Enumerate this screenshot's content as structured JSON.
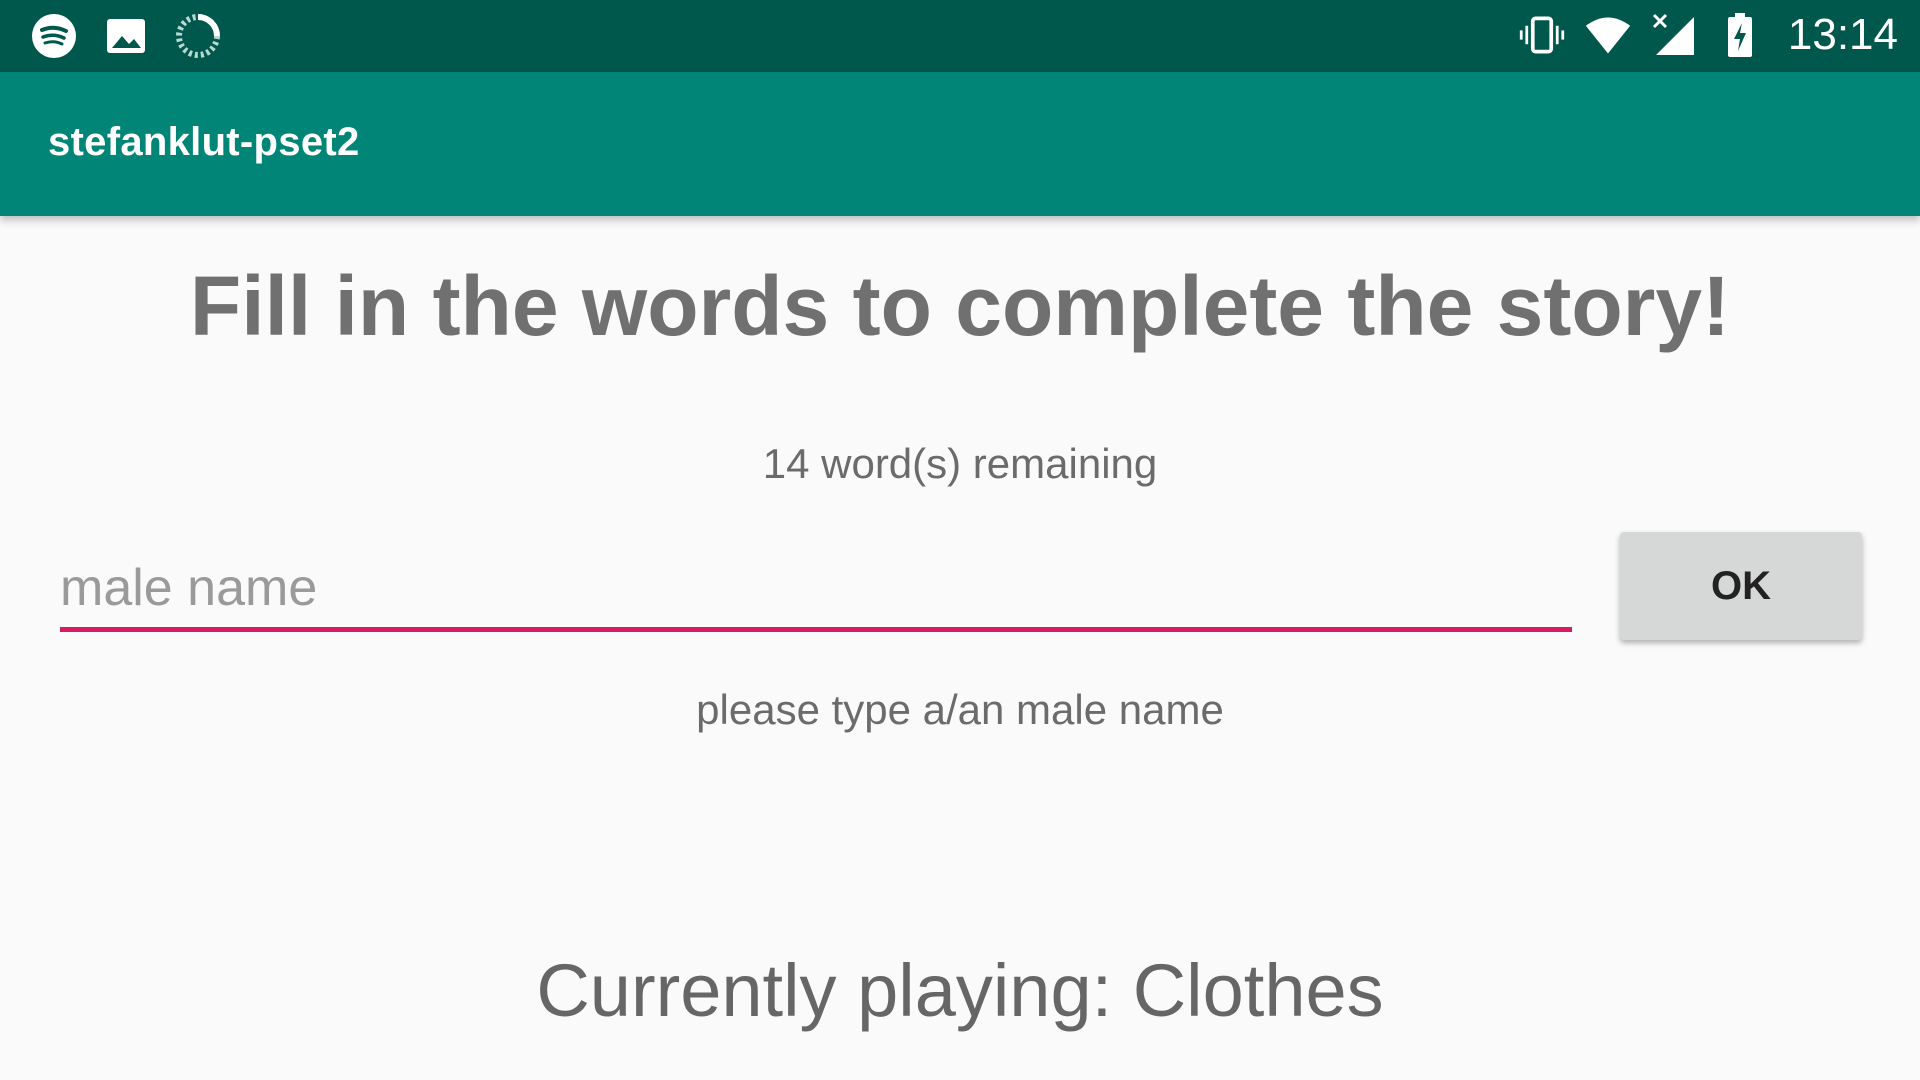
{
  "status_bar": {
    "time": "13:14",
    "left_icons": [
      "spotify-icon",
      "image-icon",
      "sync-progress-icon"
    ],
    "right_icons": [
      "vibrate-icon",
      "wifi-icon",
      "cell-signal-off-icon",
      "battery-charging-icon"
    ]
  },
  "app_bar": {
    "title": "stefanklut-pset2"
  },
  "main": {
    "headline": "Fill in the words to complete the story!",
    "remaining": "14 word(s) remaining",
    "input": {
      "placeholder": "male name",
      "value": ""
    },
    "ok_label": "OK",
    "hint": "please type a/an male name",
    "now_playing": "Currently playing: Clothes"
  },
  "colors": {
    "status_bar": "#00574b",
    "app_bar": "#008577",
    "accent": "#d81b60",
    "background": "#fafafa",
    "button": "#d6d7d7"
  }
}
